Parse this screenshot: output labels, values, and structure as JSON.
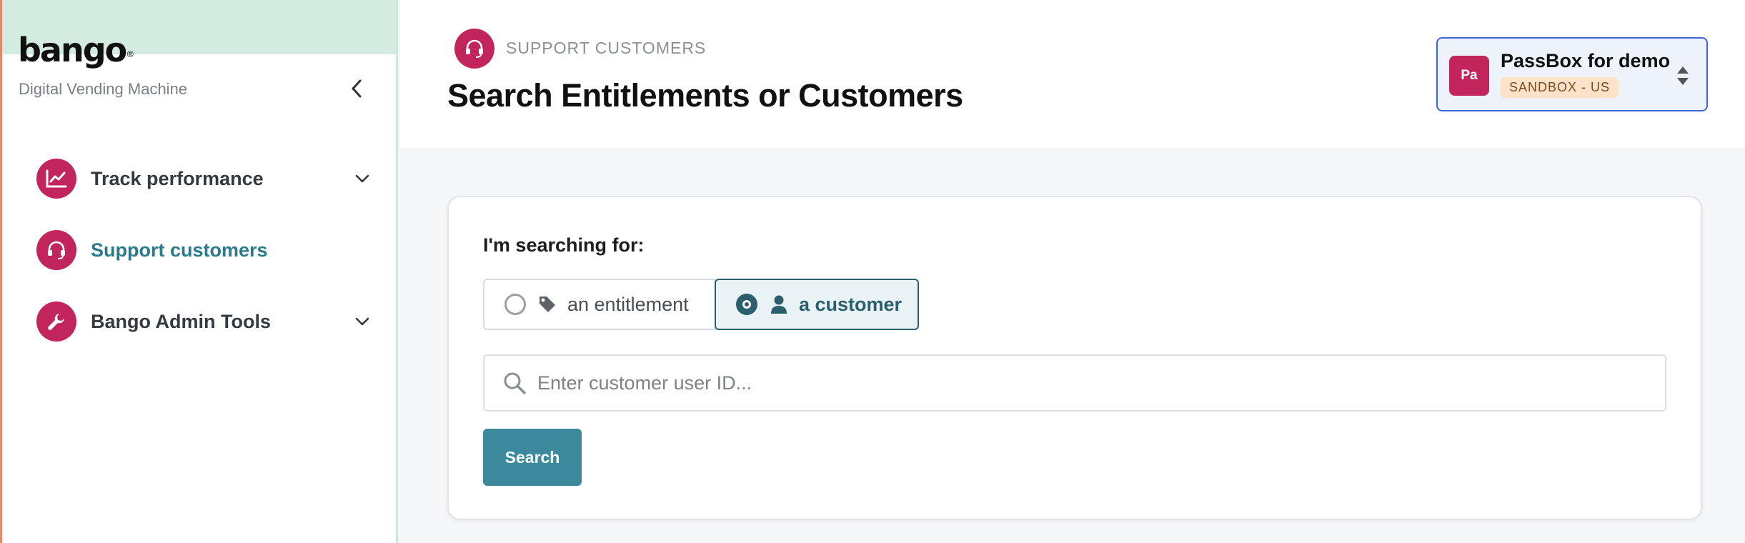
{
  "sidebar": {
    "logo_text": "bango",
    "logo_mark": "®",
    "tagline": "Digital Vending Machine",
    "collapse_icon": "chevron-left-icon",
    "items": [
      {
        "label": "Track performance",
        "icon": "line-chart-icon",
        "expandable": true,
        "active": false
      },
      {
        "label": "Support customers",
        "icon": "headset-icon",
        "expandable": false,
        "active": true
      },
      {
        "label": "Bango Admin Tools",
        "icon": "wrench-icon",
        "expandable": true,
        "active": false
      }
    ]
  },
  "header": {
    "kicker": "SUPPORT CUSTOMERS",
    "title": "Search Entitlements or Customers",
    "icon": "headset-icon"
  },
  "account": {
    "avatar": "Pa",
    "name": "PassBox for demo",
    "badge": "SANDBOX - US",
    "icon": "sort-icon"
  },
  "search": {
    "label": "I'm searching for:",
    "options": [
      {
        "label": "an entitlement",
        "icon": "tag-icon",
        "selected": false
      },
      {
        "label": "a customer",
        "icon": "user-icon",
        "selected": true
      }
    ],
    "placeholder": "Enter customer user ID...",
    "value": "",
    "button_label": "Search"
  },
  "colors": {
    "brand_band": "#d4ebe2",
    "accent_magenta": "#c2255c",
    "accent_teal": "#3a8a9c",
    "active_nav": "#2b7a8c",
    "account_border": "#3e66d6",
    "badge_bg": "#fbe2c9"
  }
}
